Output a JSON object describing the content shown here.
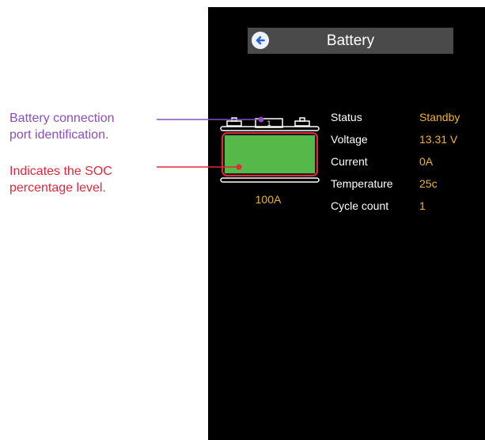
{
  "callouts": {
    "port_line1": "Battery connection",
    "port_line2": "port identification.",
    "soc_line1": "Indicates the SOC",
    "soc_line2": "percentage level."
  },
  "header": {
    "title": "Battery",
    "back_icon": "back-arrow-icon"
  },
  "battery": {
    "port_number": "1",
    "capacity_label": "100A",
    "soc_fill_fraction": 1.0,
    "fill_color": "#55b848"
  },
  "info": [
    {
      "label": "Status",
      "value": "Standby"
    },
    {
      "label": "Voltage",
      "value": "13.31 V"
    },
    {
      "label": "Current",
      "value": "0A"
    },
    {
      "label": "Temperature",
      "value": "25c"
    },
    {
      "label": "Cycle count",
      "value": "1"
    }
  ],
  "colors": {
    "screen_bg": "#000000",
    "header_bg": "#4a4a4a",
    "value_accent": "#f0b429",
    "port_callout": "#8a4fb8",
    "soc_callout": "#e0283a"
  }
}
